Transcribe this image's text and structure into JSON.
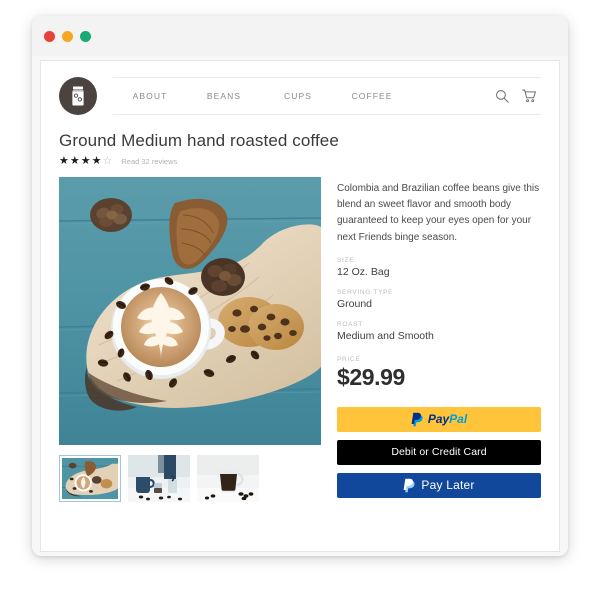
{
  "window": {
    "traffic_lights": [
      {
        "name": "close",
        "color": "#e8413a"
      },
      {
        "name": "minimize",
        "color": "#f5a623"
      },
      {
        "name": "maximize",
        "color": "#19a974"
      }
    ]
  },
  "header": {
    "logo_icon": "coffee-bag-icon",
    "nav_items": [
      {
        "label": "ABOUT"
      },
      {
        "label": "BEANS"
      },
      {
        "label": "CUPS"
      },
      {
        "label": "COFFEE"
      }
    ],
    "icons": [
      {
        "name": "search-icon"
      },
      {
        "name": "cart-icon"
      }
    ]
  },
  "product": {
    "title": "Ground Medium hand roasted coffee",
    "rating": {
      "value": 4,
      "max": 5,
      "filled_glyph": "★",
      "empty_glyph": "☆"
    },
    "reviews_label": "Read 32 reviews",
    "description": "Colombia and Brazilian coffee beans give this blend an sweet flavor and smooth body guaranteed to keep your eyes open for your next Friends binge season.",
    "attributes": [
      {
        "label": "SIZE",
        "value": "12 Oz. Bag"
      },
      {
        "label": "SERVING TYPE",
        "value": "Ground"
      },
      {
        "label": "ROAST",
        "value": "Medium and Smooth"
      }
    ],
    "price": {
      "label": "PRICE",
      "value": "$29.99"
    },
    "gallery": {
      "main_alt": "Latte art cup on wooden board with pine cones, cookies and coffee beans on teal wooden table",
      "thumbnails": [
        {
          "alt": "Latte art cup on wooden board",
          "selected": true
        },
        {
          "alt": "Blue mug and espresso pour with scattered beans",
          "selected": false
        },
        {
          "alt": "Glass cup of black coffee with beans on white",
          "selected": false
        }
      ]
    }
  },
  "payment": {
    "buttons": [
      {
        "name": "paypal",
        "text_a": "Pay",
        "text_b": "Pal",
        "bg": "#ffc439"
      },
      {
        "name": "debit-credit",
        "label": "Debit or Credit Card",
        "bg": "#000000"
      },
      {
        "name": "pay-later",
        "label": "Pay Later",
        "bg": "#11489c"
      }
    ]
  }
}
